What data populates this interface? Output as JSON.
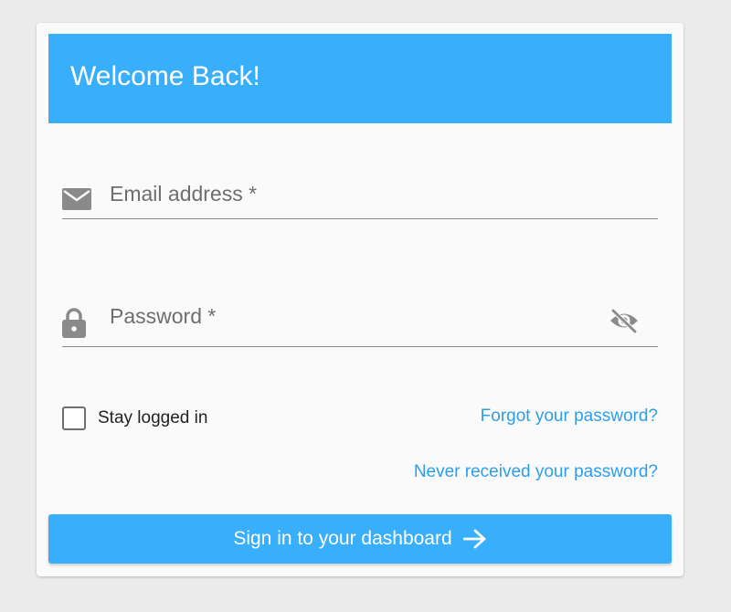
{
  "header": {
    "title": "Welcome Back!"
  },
  "form": {
    "email": {
      "placeholder": "Email address *",
      "value": "",
      "icon": "mail-icon"
    },
    "password": {
      "placeholder": "Password *",
      "value": "",
      "icon": "lock-icon",
      "toggle_icon": "eye-off-icon"
    },
    "remember": {
      "label": "Stay logged in",
      "checked": false
    },
    "forgot_link": "Forgot your password?",
    "never_received_link": "Never received your password?",
    "submit_label": "Sign in to your dashboard",
    "submit_icon": "arrow-right-icon"
  },
  "colors": {
    "page_background": "#ebebeb",
    "card_background": "#fafafa",
    "accent": "#39aefa",
    "link": "#2f9ee8",
    "icon_gray": "#8a8a8a"
  }
}
